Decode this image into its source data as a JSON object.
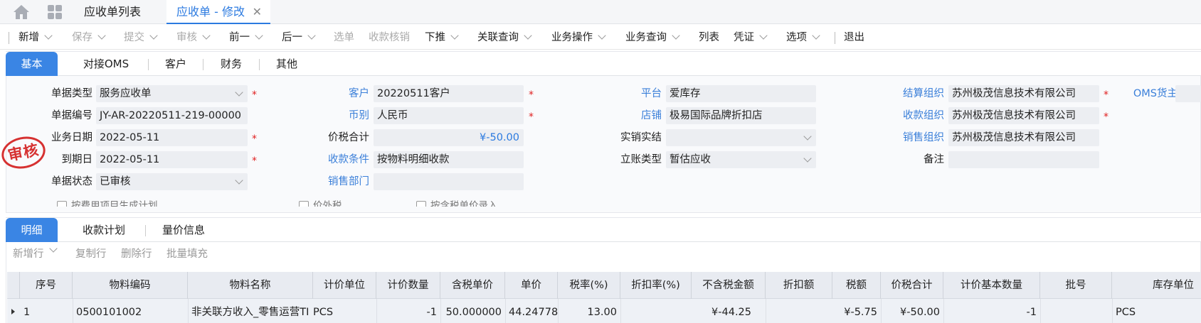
{
  "topbar": {
    "list_tab": "应收单列表",
    "active_tab": "应收单 - 修改",
    "close_glyph": "✕",
    "home_icon": "home-icon",
    "apps_icon": "apps-grid-icon"
  },
  "toolbar": {
    "items": [
      {
        "label": "新增",
        "disabled": false,
        "chevron": true
      },
      {
        "label": "保存",
        "disabled": true,
        "chevron": true
      },
      {
        "label": "提交",
        "disabled": true,
        "chevron": true
      },
      {
        "label": "审核",
        "disabled": true,
        "chevron": true
      },
      {
        "label": "前一",
        "disabled": false,
        "chevron": true
      },
      {
        "label": "后一",
        "disabled": false,
        "chevron": true
      },
      {
        "label": "选单",
        "disabled": true,
        "chevron": false
      },
      {
        "label": "收款核销",
        "disabled": true,
        "chevron": false
      },
      {
        "label": "下推",
        "disabled": false,
        "chevron": true
      },
      {
        "label": "关联查询",
        "disabled": false,
        "chevron": true
      },
      {
        "label": "业务操作",
        "disabled": false,
        "chevron": true
      },
      {
        "label": "业务查询",
        "disabled": false,
        "chevron": true
      },
      {
        "label": "列表",
        "disabled": false,
        "chevron": false
      },
      {
        "label": "凭证",
        "disabled": false,
        "chevron": true
      },
      {
        "label": "选项",
        "disabled": false,
        "chevron": true
      },
      {
        "label": "退出",
        "disabled": false,
        "chevron": false
      }
    ]
  },
  "header_tabs": [
    "基本",
    "对接OMS",
    "客户",
    "财务",
    "其他"
  ],
  "form": {
    "bill_type": {
      "label": "单据类型",
      "value": "服务应收单"
    },
    "bill_no": {
      "label": "单据编号",
      "value": "JY-AR-20220511-219-00000"
    },
    "biz_date": {
      "label": "业务日期",
      "value": "2022-05-11"
    },
    "due_date": {
      "label": "到期日",
      "value": "2022-05-11"
    },
    "status": {
      "label": "单据状态",
      "value": "已审核"
    },
    "customer": {
      "label": "客户",
      "value": "20220511客户"
    },
    "currency": {
      "label": "币别",
      "value": "人民币"
    },
    "total": {
      "label": "价税合计",
      "value": "¥-50.00"
    },
    "pay_terms": {
      "label": "收款条件",
      "value": "按物料明细收款"
    },
    "sale_dept": {
      "label": "销售部门",
      "value": ""
    },
    "platform": {
      "label": "平台",
      "value": "爱库存"
    },
    "shop": {
      "label": "店铺",
      "value": "极易国际品牌折扣店"
    },
    "actual_sale": {
      "label": "实销实结",
      "value": ""
    },
    "account_type": {
      "label": "立账类型",
      "value": "暂估应收"
    },
    "settle_org": {
      "label": "结算组织",
      "value": "苏州极茂信息技术有限公司"
    },
    "receive_org": {
      "label": "收款组织",
      "value": "苏州极茂信息技术有限公司"
    },
    "sale_org": {
      "label": "销售组织",
      "value": "苏州极茂信息技术有限公司"
    },
    "remark": {
      "label": "备注",
      "value": ""
    },
    "oms_owner": {
      "label": "OMS货主",
      "value": ""
    },
    "req": "*",
    "checkboxes": [
      "按费用项目生成计划",
      "价外税",
      "按含税单价录入"
    ]
  },
  "stamp": "审核",
  "detail_tabs": [
    "明细",
    "收款计划",
    "量价信息"
  ],
  "detail_toolbar": [
    "新增行",
    "复制行",
    "删除行",
    "批量填充"
  ],
  "grid": {
    "columns": [
      "序号",
      "物料编码",
      "物料名称",
      "计价单位",
      "计价数量",
      "含税单价",
      "单价",
      "税率(%)",
      "折扣率(%)",
      "不含税金额",
      "折扣额",
      "税额",
      "价税合计",
      "计价基本数量",
      "批号",
      "库存单位"
    ],
    "rows": [
      [
        "1",
        "0500101002",
        "非关联方收入_零售运营TI",
        "PCS",
        "-1",
        "50.000000",
        "44.24778",
        "13.00",
        "",
        "¥-44.25",
        "",
        "¥-5.75",
        "¥-50.00",
        "-1",
        "",
        "PCS"
      ]
    ]
  },
  "colors": {
    "accent": "#3a85e4",
    "link_label": "#3a7fd9",
    "required": "#e02020",
    "stamp": "#d63131"
  }
}
